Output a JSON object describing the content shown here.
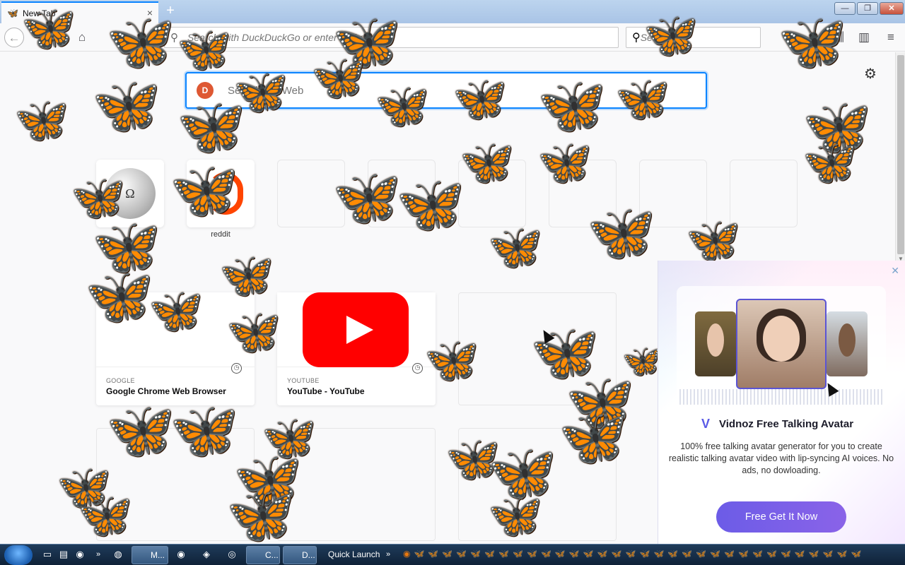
{
  "browser": {
    "tab_title": "New Tab",
    "tab_favicon": "butterfly-icon",
    "new_tab": "+",
    "window_controls": {
      "minimize": "—",
      "maximize": "❐",
      "close": "✕"
    }
  },
  "toolbar": {
    "url_placeholder": "Search with DuckDuckGo or enter address",
    "search_placeholder": "Search",
    "icons": [
      "back-icon",
      "reload-icon",
      "home-icon",
      "search-icon",
      "library-icon",
      "sidebar-icon",
      "menu-icon"
    ]
  },
  "newtab": {
    "web_search_placeholder": "Search the Web",
    "web_search_provider": "DuckDuckGo",
    "top_sites": [
      {
        "label": "",
        "icon": "wikipedia-icon"
      },
      {
        "label": "reddit",
        "icon": "reddit-icon"
      }
    ],
    "highlights": [
      {
        "source": "GOOGLE",
        "title": "Google Chrome Web Browser"
      },
      {
        "source": "YOUTUBE",
        "title": "YouTube - YouTube"
      }
    ]
  },
  "ad": {
    "brand": "Vidnoz Free Talking Avatar",
    "description": "100% free talking avatar generator for you to create realistic talking avatar video with lip-syncing AI voices. No ads, no dowloading.",
    "cta": "Free Get It Now",
    "close": "✕"
  },
  "taskbar": {
    "tasks": [
      {
        "label": "M..."
      },
      {
        "label": "C..."
      },
      {
        "label": "D..."
      }
    ],
    "quick_launch": "Quick Launch",
    "chevron": "»"
  },
  "colors": {
    "accent": "#0a84ff",
    "butterfly": "#e8780f",
    "youtube": "#ff0000",
    "ad_button": "#6c5ce7"
  }
}
